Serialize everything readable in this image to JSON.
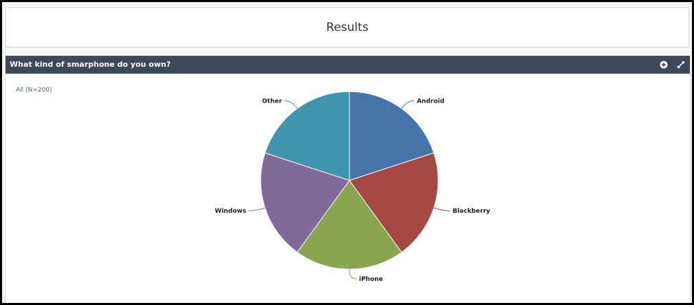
{
  "page": {
    "title": "Results"
  },
  "panel": {
    "title": "What kind of smarphone do you own?"
  },
  "filter": {
    "label": "All (N=200)"
  },
  "icons": {
    "add": "plus-circle-icon",
    "expand": "expand-icon"
  },
  "chart_data": {
    "type": "pie",
    "title": "What kind of smarphone do you own?",
    "categories": [
      "Android",
      "Blackberry",
      "iPhone",
      "Windows",
      "Other"
    ],
    "values": [
      40,
      40,
      40,
      40,
      40
    ],
    "colors": [
      "#4673a8",
      "#a84846",
      "#89a54e",
      "#7f6a9a",
      "#3d96ae"
    ]
  }
}
